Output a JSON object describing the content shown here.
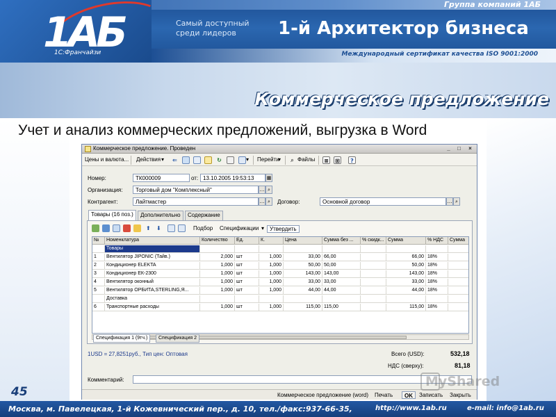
{
  "header": {
    "group": "Группа компаний 1АБ",
    "logo_number": "1АБ",
    "logo_sub": "1С:Франчайзи",
    "slogan": "Самый доступный среди лидеров",
    "title": "1-й Архитектор бизнеса",
    "iso": "Международный сертификат качества ISO 9001:2000"
  },
  "slide": {
    "title": "Коммерческое предложение",
    "subtitle": "Учет и анализ коммерческих предложений, выгрузка в Word",
    "page_number": "45"
  },
  "window": {
    "title": "Коммерческое предложение. Проведен",
    "toolbar": {
      "prices": "Цены и валюта...",
      "actions": "Действия",
      "goto": "Перейти",
      "files": "Файлы"
    },
    "form": {
      "number_label": "Номер:",
      "number": "ТК000009",
      "date_label": "от:",
      "date": "13.10.2005 19:53:13",
      "org_label": "Организация:",
      "org": "Торговый дом \"Комплексный\"",
      "contractor_label": "Контрагент:",
      "contractor": "Лайтмастер",
      "contract_label": "Договор:",
      "contract": "Основной договор"
    },
    "tabs": [
      "Товары (16 поз.)",
      "Дополнительно",
      "Содержание"
    ],
    "panel_toolbar": {
      "select": "Подбор",
      "specs": "Спецификации",
      "approve": "Утвердить"
    },
    "table": {
      "columns": [
        "№",
        "Номенклатура",
        "Количество",
        "Ед.",
        "К.",
        "Цена",
        "Сумма без ...",
        "% скидк...",
        "Сумма",
        "% НДС",
        "Сумма"
      ],
      "rows": [
        [
          "",
          "Товары",
          "",
          "",
          "",
          "",
          "",
          "",
          "",
          "",
          ""
        ],
        [
          "1",
          "Вентилятор JIPONIC (Тайв.)",
          "2,000",
          "шт",
          "1,000",
          "33,00",
          "66,00",
          "",
          "66,00",
          "18%",
          ""
        ],
        [
          "2",
          "Кондиционер ELEKTA",
          "1,000",
          "шт",
          "1,000",
          "50,00",
          "50,00",
          "",
          "50,00",
          "18%",
          ""
        ],
        [
          "3",
          "Кондиционер ЕК-2300",
          "1,000",
          "шт",
          "1,000",
          "143,00",
          "143,00",
          "",
          "143,00",
          "18%",
          ""
        ],
        [
          "4",
          "Вентилятор оконный",
          "1,000",
          "шт",
          "1,000",
          "33,00",
          "33,00",
          "",
          "33,00",
          "18%",
          ""
        ],
        [
          "5",
          "Вентилятор ОРБИТА,STERLING,Я...",
          "1,000",
          "шт",
          "1,000",
          "44,00",
          "44,00",
          "",
          "44,00",
          "18%",
          ""
        ],
        [
          "",
          "Доставка",
          "",
          "",
          "",
          "",
          "",
          "",
          "",
          "",
          ""
        ],
        [
          "6",
          "Транспортные расходы",
          "1,000",
          "шт",
          "1,000",
          "115,00",
          "115,00",
          "",
          "115,00",
          "18%",
          ""
        ]
      ]
    },
    "bottom_tabs": [
      "Спецификация 1 (9тч.)",
      "Спецификация 2"
    ],
    "rate_info": "1USD = 27,8251руб., Тип цен: Оптовая",
    "total_label": "Всего (USD):",
    "total": "532,18",
    "vat_label": "НДС (сверху):",
    "vat": "81,18",
    "comment_label": "Комментарий:",
    "status_bar": {
      "doc": "Коммерческое предложение (word)",
      "print": "Печать",
      "ok": "OK",
      "save": "Записать",
      "close": "Закрыть"
    }
  },
  "watermark": "MyShared",
  "footer": {
    "address": "Москва, м. Павелецкая, 1-й Кожевнический пер., д. 10, тел./факс:937-66-35,",
    "url": "http://www.1ab.ru",
    "email": "e-mail: info@1ab.ru"
  },
  "colors": {
    "brand_blue": "#1d4f94",
    "accent_red": "#e0392b",
    "selection": "#1c3a8c"
  }
}
